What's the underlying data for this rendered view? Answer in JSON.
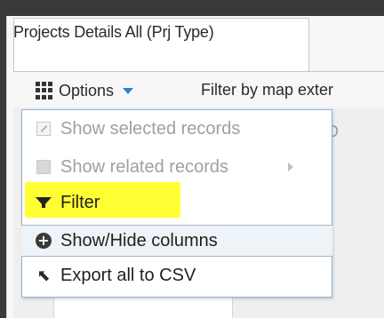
{
  "tab": {
    "label": "Projects Details All (Prj Type)"
  },
  "toolbar": {
    "options_label": "Options",
    "filter_extent_label": "Filter by map exter"
  },
  "menu": {
    "items": [
      {
        "label": "Show selected records",
        "icon": "pin-icon",
        "enabled": false
      },
      {
        "label": "Show related records",
        "icon": "related-records-icon",
        "enabled": false
      },
      {
        "label": "Filter",
        "icon": "filter-icon",
        "enabled": true,
        "highlight_color": "#ffff33"
      },
      {
        "label": "Show/Hide columns",
        "icon": "plus-circle-icon",
        "enabled": true
      },
      {
        "label": "Export all to CSV",
        "icon": "export-arrow-icon",
        "enabled": true
      }
    ]
  },
  "background": {
    "stub_text": "D"
  },
  "colors": {
    "accent": "#2f7fd0",
    "menu_border": "#8fb2d6",
    "highlight": "#ffff33"
  }
}
